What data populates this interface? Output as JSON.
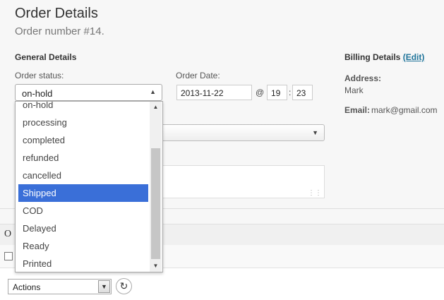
{
  "page": {
    "title": "Order Details",
    "subtitle": "Order number #14."
  },
  "general": {
    "heading": "General Details",
    "status_label": "Order status:",
    "status_value": "on-hold",
    "date_label": "Order Date:",
    "date_value": "2013-11-22",
    "at": "@",
    "hour": "19",
    "colon": ":",
    "minute": "23"
  },
  "billing": {
    "heading": "Billing Details",
    "edit_label": "(Edit)",
    "address_label": "Address:",
    "address_value": "Mark",
    "email_label": "Email:",
    "email_value": "mark@gmail.com"
  },
  "dropdown": {
    "options": [
      "on-hold",
      "processing",
      "completed",
      "refunded",
      "cancelled",
      "Shipped",
      "COD",
      "Delayed",
      "Ready",
      "Printed"
    ],
    "selected": "Shipped"
  },
  "lower": {
    "bar_text": "O",
    "actions_value": "Actions"
  },
  "icons": {
    "dropdown_arrow": "chevron-up-icon",
    "refresh": "refresh-icon",
    "resize": "resize-grip-icon"
  },
  "colors": {
    "selected_option": "#3a6fd8",
    "link": "#21759b"
  }
}
